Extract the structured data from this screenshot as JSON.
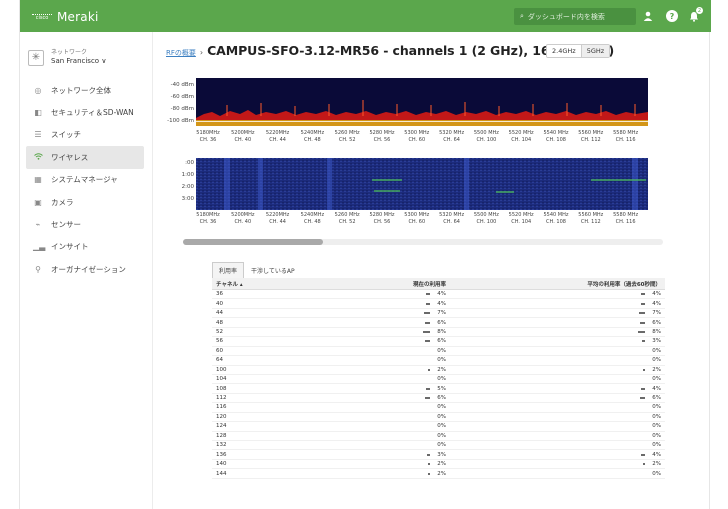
{
  "header": {
    "cisco_label": "cisco",
    "brand": "Meraki",
    "search_placeholder": "ダッシュボード内を検索",
    "notification_count": "2"
  },
  "sidebar": {
    "network_label": "ネットワーク",
    "network_value": "San Francisco ∨",
    "items": [
      {
        "label": "ネットワーク全体",
        "icon": "globe-icon"
      },
      {
        "label": "セキュリティ＆SD-WAN",
        "icon": "shield-icon"
      },
      {
        "label": "スイッチ",
        "icon": "switch-icon"
      },
      {
        "label": "ワイヤレス",
        "icon": "wifi-icon"
      },
      {
        "label": "システムマネージャ",
        "icon": "devices-icon"
      },
      {
        "label": "カメラ",
        "icon": "camera-icon"
      },
      {
        "label": "センサー",
        "icon": "sensor-icon"
      },
      {
        "label": "インサイト",
        "icon": "chart-icon"
      },
      {
        "label": "オーガナイゼーション",
        "icon": "org-icon"
      }
    ]
  },
  "page": {
    "breadcrumb": "RFの概要",
    "separator": "›",
    "title": "CAMPUS-SFO-3.12-MR56 - channels 1 (2 GHz), 165 (5 GHz)",
    "band_24": "2.4GHz",
    "band_5": "5GHz"
  },
  "spectrum": {
    "top_ylabels": [
      "-40 dBm",
      "-60 dBm",
      "-80 dBm",
      "-100 dBm"
    ],
    "bottom_ylabels": [
      ":00",
      "1:00",
      "2:00",
      "3:00"
    ],
    "freq_ticks": [
      {
        "mhz": "5180MHz",
        "ch": "CH. 36"
      },
      {
        "mhz": "5200MHz",
        "ch": "CH. 40"
      },
      {
        "mhz": "5220MHz",
        "ch": "CH. 44"
      },
      {
        "mhz": "5240MHz",
        "ch": "CH. 48"
      },
      {
        "mhz": "5260 MHz",
        "ch": "CH. 52"
      },
      {
        "mhz": "5280 MHz",
        "ch": "CH. 56"
      },
      {
        "mhz": "5300 MHz",
        "ch": "CH. 60"
      },
      {
        "mhz": "5320 MHz",
        "ch": "CH. 64"
      },
      {
        "mhz": "5500 MHz",
        "ch": "CH. 100"
      },
      {
        "mhz": "5520 MHz",
        "ch": "CH. 104"
      },
      {
        "mhz": "5540 MHz",
        "ch": "CH. 108"
      },
      {
        "mhz": "5560 MHz",
        "ch": "CH. 112"
      },
      {
        "mhz": "5580 MHz",
        "ch": "CH. 116"
      }
    ],
    "bottom_freq_ticks": [
      {
        "mhz": "5180MHz",
        "ch": "CH. 36"
      },
      {
        "mhz": "5200MHz",
        "ch": "CH. 40"
      },
      {
        "mhz": "5220MHz",
        "ch": "CH. 44"
      },
      {
        "mhz": "5240MHz",
        "ch": "CH. 48"
      },
      {
        "mhz": "5260 MHz",
        "ch": "CH. 52"
      },
      {
        "mhz": "5280 MHz",
        "ch": "CH. 56"
      },
      {
        "mhz": "5300 MHz",
        "ch": "CH. 60"
      },
      {
        "mhz": "5320 MHz",
        "ch": "CH. 64"
      },
      {
        "mhz": "5500 MHz",
        "ch": "CH. 100"
      },
      {
        "mhz": "5520 MHz",
        "ch": "CH. 104"
      },
      {
        "mhz": "5540 MHz",
        "ch": "CH. 108"
      },
      {
        "mhz": "5560 MHz",
        "ch": "CH. 112"
      },
      {
        "mhz": "5580 MHz",
        "ch": "CH. 116"
      }
    ]
  },
  "tabs": [
    "利用率",
    "干渉しているAP"
  ],
  "table": {
    "headers": [
      "チャネル ▴",
      "現在の利用率",
      "平均の利用率（過去60秒間）"
    ],
    "rows": [
      {
        "ch": "36",
        "cur": "4%",
        "avg": "4%"
      },
      {
        "ch": "40",
        "cur": "4%",
        "avg": "4%"
      },
      {
        "ch": "44",
        "cur": "7%",
        "avg": "7%"
      },
      {
        "ch": "48",
        "cur": "6%",
        "avg": "6%"
      },
      {
        "ch": "52",
        "cur": "8%",
        "avg": "8%"
      },
      {
        "ch": "56",
        "cur": "6%",
        "avg": "3%"
      },
      {
        "ch": "60",
        "cur": "0%",
        "avg": "0%"
      },
      {
        "ch": "64",
        "cur": "0%",
        "avg": "0%"
      },
      {
        "ch": "100",
        "cur": "2%",
        "avg": "2%"
      },
      {
        "ch": "104",
        "cur": "0%",
        "avg": "0%"
      },
      {
        "ch": "108",
        "cur": "5%",
        "avg": "4%"
      },
      {
        "ch": "112",
        "cur": "6%",
        "avg": "6%"
      },
      {
        "ch": "116",
        "cur": "0%",
        "avg": "0%"
      },
      {
        "ch": "120",
        "cur": "0%",
        "avg": "0%"
      },
      {
        "ch": "124",
        "cur": "0%",
        "avg": "0%"
      },
      {
        "ch": "128",
        "cur": "0%",
        "avg": "0%"
      },
      {
        "ch": "132",
        "cur": "0%",
        "avg": "0%"
      },
      {
        "ch": "136",
        "cur": "3%",
        "avg": "4%"
      },
      {
        "ch": "140",
        "cur": "2%",
        "avg": "2%"
      },
      {
        "ch": "144",
        "cur": "2%",
        "avg": "0%"
      }
    ]
  },
  "colors": {
    "accent": "#5ba74c",
    "link": "#3c7fc1"
  }
}
